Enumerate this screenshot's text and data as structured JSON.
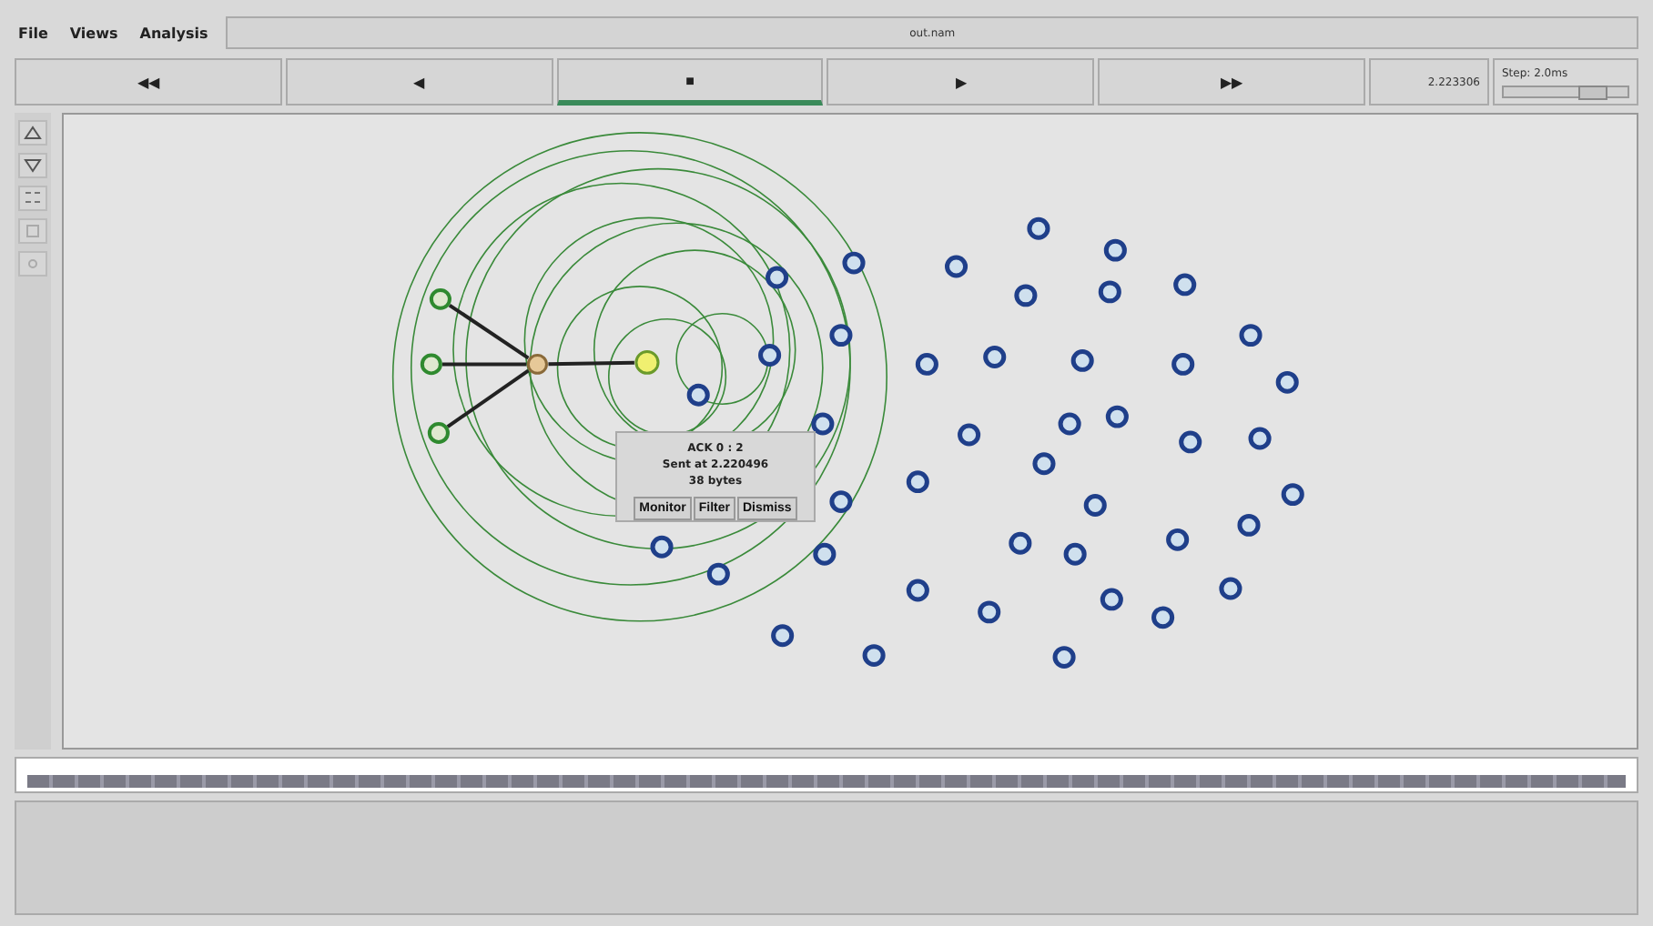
{
  "menu": [
    {
      "label": "File"
    },
    {
      "label": "Views"
    },
    {
      "label": "Analysis"
    }
  ],
  "file_title": "out.nam",
  "controls": [
    {
      "glyph": "◀◀",
      "selected": false
    },
    {
      "glyph": "◀",
      "selected": false
    },
    {
      "glyph": "■",
      "selected": true
    },
    {
      "glyph": "▶",
      "selected": false
    },
    {
      "glyph": "▶▶",
      "selected": false
    }
  ],
  "time": "2.223306",
  "step": {
    "label": "Step: 2.0ms",
    "level": 0.7
  },
  "packet_popup": {
    "lines": [
      "ACK 0 : 2",
      "Sent at 2.220496",
      "38 bytes"
    ],
    "buttons": [
      "Monitor",
      "Filter",
      "Dismiss"
    ]
  }
}
